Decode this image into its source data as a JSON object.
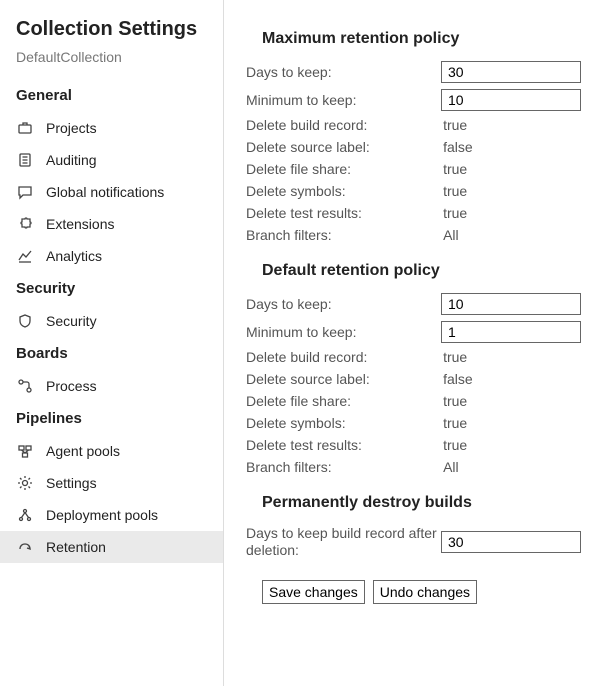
{
  "sidebar": {
    "title": "Collection Settings",
    "subtitle": "DefaultCollection",
    "groups": {
      "general": {
        "header": "General",
        "items": {
          "projects": "Projects",
          "auditing": "Auditing",
          "globalNotifications": "Global notifications",
          "extensions": "Extensions",
          "analytics": "Analytics"
        }
      },
      "security": {
        "header": "Security",
        "items": {
          "security": "Security"
        }
      },
      "boards": {
        "header": "Boards",
        "items": {
          "process": "Process"
        }
      },
      "pipelines": {
        "header": "Pipelines",
        "items": {
          "agentPools": "Agent pools",
          "settings": "Settings",
          "deploymentPools": "Deployment pools",
          "retention": "Retention"
        }
      }
    }
  },
  "main": {
    "maxPolicy": {
      "title": "Maximum retention policy",
      "daysToKeepLabel": "Days to keep:",
      "daysToKeepValue": "30",
      "minToKeepLabel": "Minimum to keep:",
      "minToKeepValue": "10",
      "deleteBuildRecordLabel": "Delete build record:",
      "deleteBuildRecordValue": "true",
      "deleteSourceLabelLabel": "Delete source label:",
      "deleteSourceLabelValue": "false",
      "deleteFileShareLabel": "Delete file share:",
      "deleteFileShareValue": "true",
      "deleteSymbolsLabel": "Delete symbols:",
      "deleteSymbolsValue": "true",
      "deleteTestResultsLabel": "Delete test results:",
      "deleteTestResultsValue": "true",
      "branchFiltersLabel": "Branch filters:",
      "branchFiltersValue": "All"
    },
    "defaultPolicy": {
      "title": "Default retention policy",
      "daysToKeepLabel": "Days to keep:",
      "daysToKeepValue": "10",
      "minToKeepLabel": "Minimum to keep:",
      "minToKeepValue": "1",
      "deleteBuildRecordLabel": "Delete build record:",
      "deleteBuildRecordValue": "true",
      "deleteSourceLabelLabel": "Delete source label:",
      "deleteSourceLabelValue": "false",
      "deleteFileShareLabel": "Delete file share:",
      "deleteFileShareValue": "true",
      "deleteSymbolsLabel": "Delete symbols:",
      "deleteSymbolsValue": "true",
      "deleteTestResultsLabel": "Delete test results:",
      "deleteTestResultsValue": "true",
      "branchFiltersLabel": "Branch filters:",
      "branchFiltersValue": "All"
    },
    "destroy": {
      "title": "Permanently destroy builds",
      "daysLabel": "Days to keep build record after deletion:",
      "daysValue": "30"
    },
    "buttons": {
      "save": "Save changes",
      "undo": "Undo changes"
    }
  }
}
